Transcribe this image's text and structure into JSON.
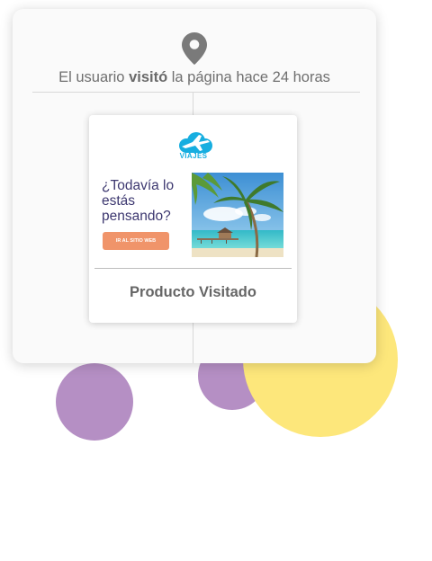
{
  "activity": {
    "caption_before": "El usuario ",
    "caption_bold": "visitó",
    "caption_after": " la página hace 24 horas",
    "icon": "location-pin-icon"
  },
  "ad": {
    "brand": "VIAJES",
    "headline": "¿Todavía lo estás pensando?",
    "cta_label": "IR AL SITIO WEB",
    "image": "tropical-beach-photo"
  },
  "product": {
    "title": "Producto Visitado"
  },
  "colors": {
    "brand_blue": "#17aee0",
    "headline_purple": "#3d3870",
    "cta_orange": "#f0946a",
    "bubble_purple": "#b58fc4",
    "bubble_yellow": "#fde77b"
  }
}
